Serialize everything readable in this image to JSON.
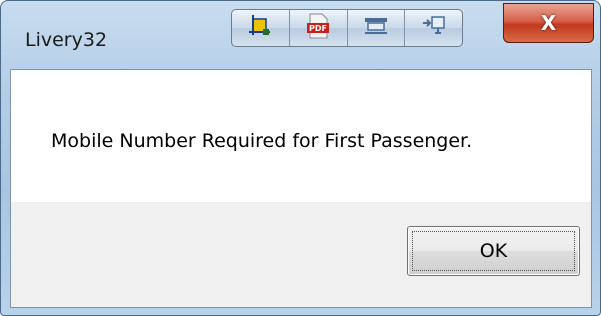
{
  "window": {
    "title": "Livery32",
    "close_label": "X"
  },
  "toolbar": {
    "buttons": [
      {
        "icon": "crop-icon"
      },
      {
        "icon": "pdf-icon",
        "label": "PDF"
      },
      {
        "icon": "printer-icon"
      },
      {
        "icon": "export-icon"
      }
    ]
  },
  "dialog": {
    "message": "Mobile Number Required for First Passenger.",
    "ok_label": "OK"
  },
  "colors": {
    "titlebar": "#b3cde6",
    "close_button": "#c0391f",
    "client_background": "#f0f0f0",
    "message_background": "#ffffff"
  }
}
